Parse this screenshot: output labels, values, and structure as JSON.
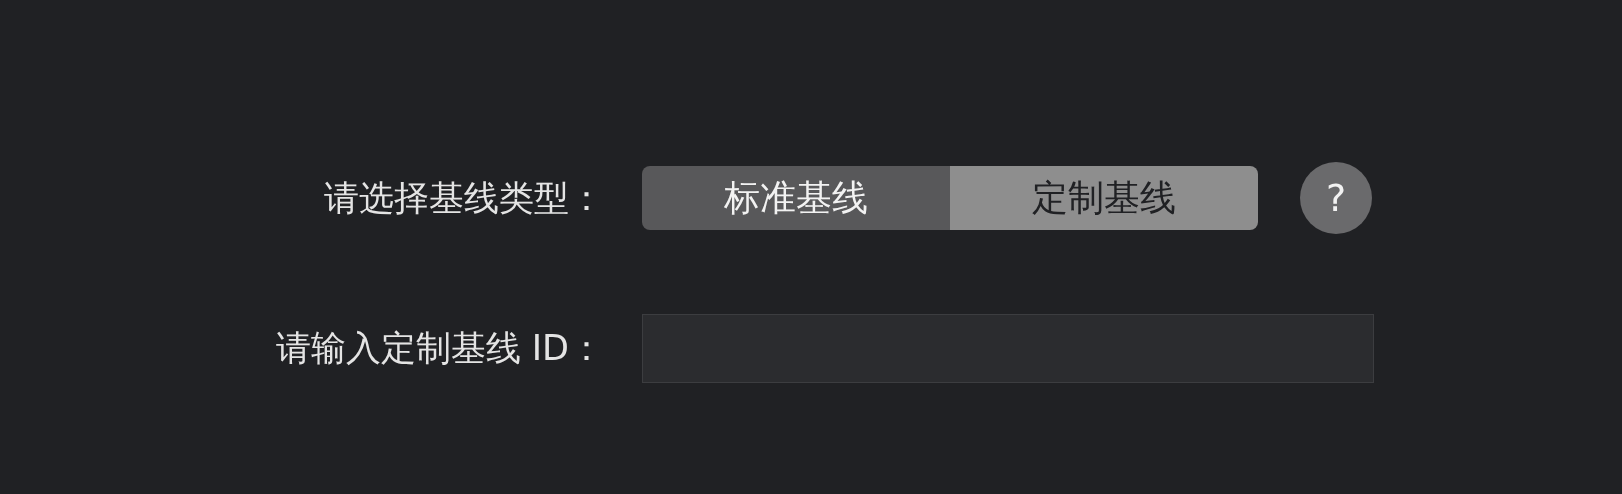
{
  "baseline_type": {
    "label": "请选择基线类型：",
    "options": [
      {
        "label": "标准基线",
        "selected": false
      },
      {
        "label": "定制基线",
        "selected": true
      }
    ],
    "help": "?"
  },
  "custom_id": {
    "label": "请输入定制基线 ID："
  }
}
